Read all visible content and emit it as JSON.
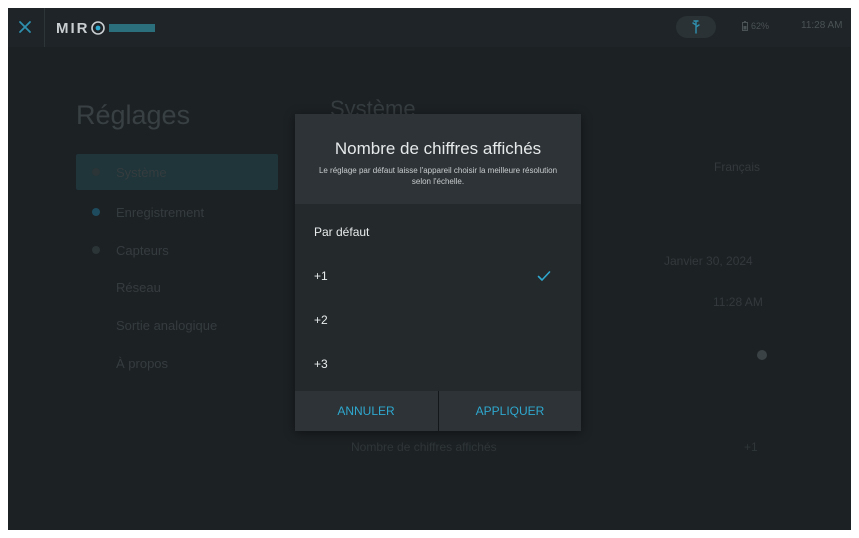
{
  "topbar": {
    "logo_text": "MIR",
    "logo_badge": "",
    "battery": "62%",
    "time": "11:28 AM"
  },
  "page": {
    "breadcrumb": "",
    "title": "Réglages",
    "section_title": "Système",
    "nav": [
      {
        "label": "Système"
      },
      {
        "label": "Enregistrement"
      },
      {
        "label": "Capteurs"
      },
      {
        "label": "Réseau"
      },
      {
        "label": "Sortie analogique"
      },
      {
        "label": "À propos"
      }
    ],
    "right_values": [
      "Français",
      "Janvier 30, 2024",
      "11:28 AM"
    ],
    "digits_row_label": "Nombre de chiffres affichés",
    "digits_row_value": "+1"
  },
  "dialog": {
    "title": "Nombre de chiffres affichés",
    "description": "Le réglage par défaut laisse l'appareil choisir la meilleure résolution selon l'échelle.",
    "options": [
      {
        "label": "Par défaut",
        "selected": false
      },
      {
        "label": "+1",
        "selected": true
      },
      {
        "label": "+2",
        "selected": false
      },
      {
        "label": "+3",
        "selected": false
      }
    ],
    "cancel_label": "ANNULER",
    "apply_label": "APPLIQUER"
  },
  "colors": {
    "accent": "#2fa8cf",
    "background": "#1c2124",
    "dialog": "#24292c"
  },
  "icons": [
    "close-icon",
    "usb-icon",
    "battery-icon",
    "checkmark-icon"
  ]
}
